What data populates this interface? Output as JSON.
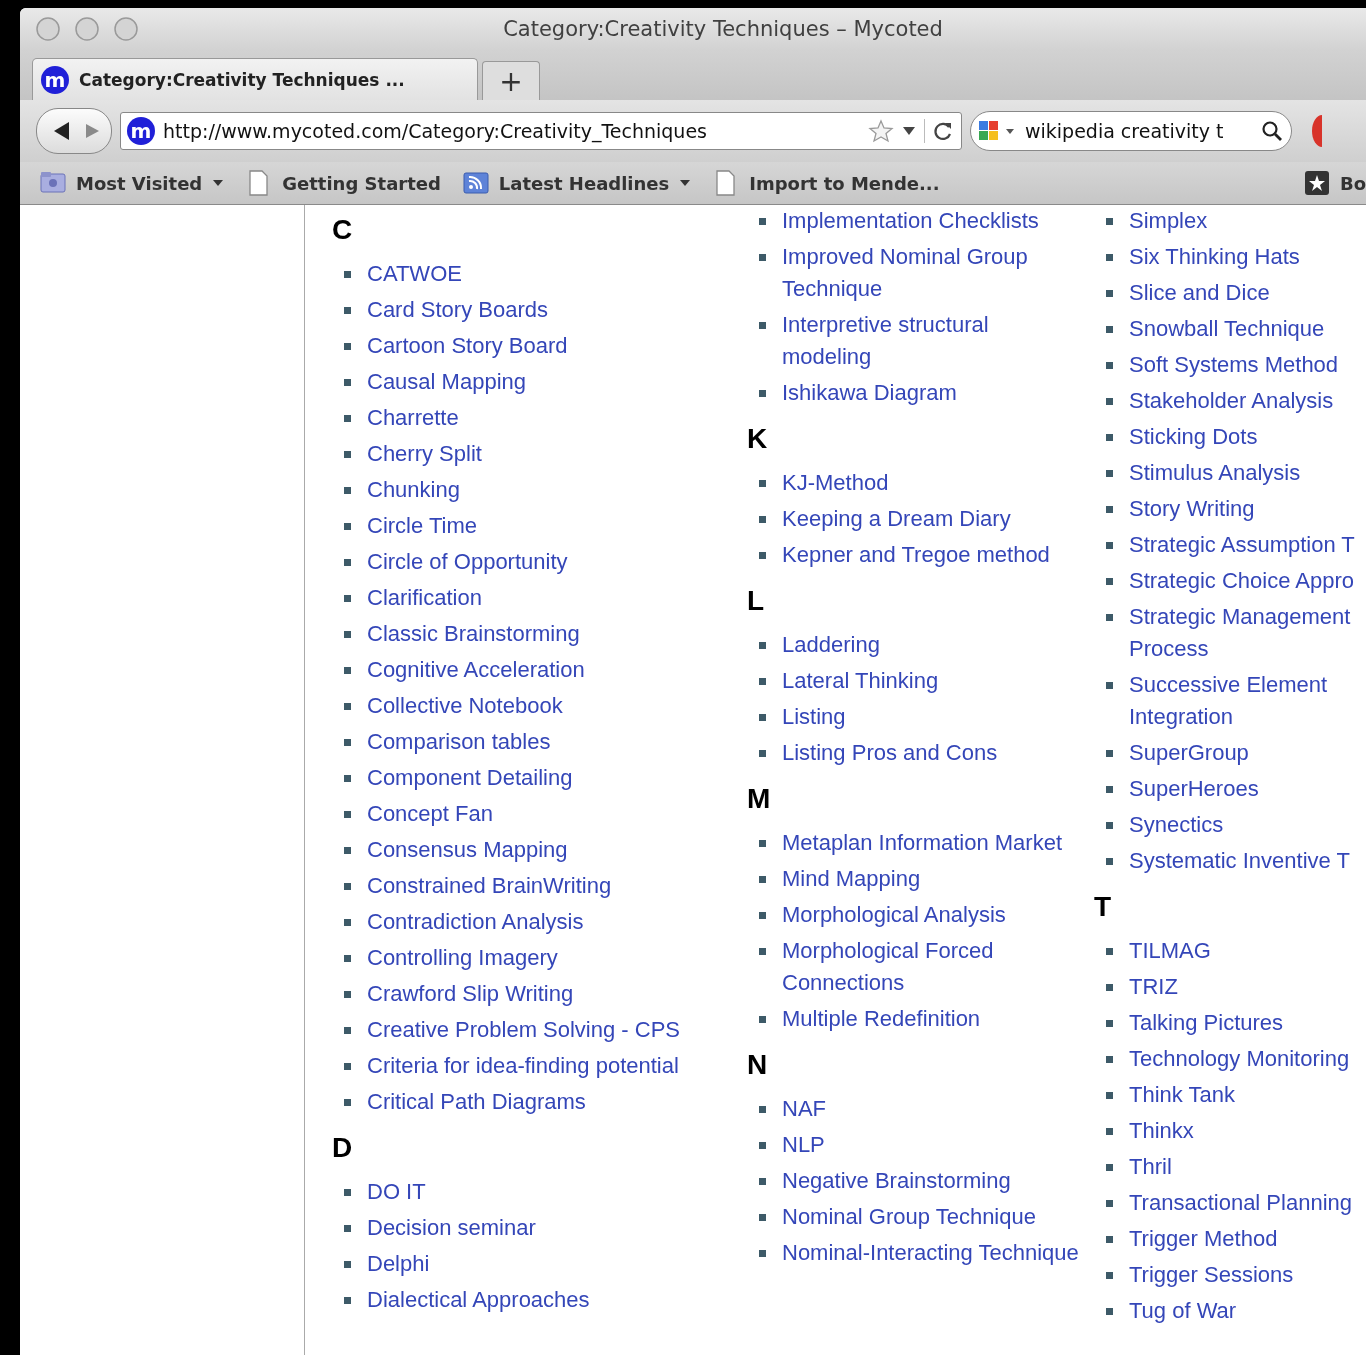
{
  "window": {
    "title": "Category:Creativity Techniques – Mycoted"
  },
  "tabs": [
    {
      "label": "Category:Creativity Techniques ...",
      "favicon": "m",
      "selected": true
    }
  ],
  "new_tab": "+",
  "address_bar": {
    "favicon": "m",
    "url": "http://www.mycoted.com/Category:Creativity_Techniques"
  },
  "search": {
    "value": "wikipedia creativity t"
  },
  "bookmarks": [
    {
      "label": "Most Visited",
      "kind": "folder",
      "menu": true
    },
    {
      "label": "Getting Started",
      "kind": "page",
      "menu": false
    },
    {
      "label": "Latest Headlines",
      "kind": "feed",
      "menu": true
    },
    {
      "label": "Import to Mende...",
      "kind": "page",
      "menu": false
    },
    {
      "label": "Bo",
      "kind": "star",
      "menu": false
    }
  ],
  "columns": [
    {
      "sections": [
        {
          "heading": "C",
          "items": [
            "CATWOE",
            "Card Story Boards",
            "Cartoon Story Board",
            "Causal Mapping",
            "Charrette",
            "Cherry Split",
            "Chunking",
            "Circle Time",
            "Circle of Opportunity",
            "Clarification",
            "Classic Brainstorming",
            "Cognitive Acceleration",
            "Collective Notebook",
            "Comparison tables",
            "Component Detailing",
            "Concept Fan",
            "Consensus Mapping",
            "Constrained BrainWriting",
            "Contradiction Analysis",
            "Controlling Imagery",
            "Crawford Slip Writing",
            "Creative Problem Solving - CPS",
            "Criteria for idea-finding potential",
            "Critical Path Diagrams"
          ]
        },
        {
          "heading": "D",
          "items": [
            "DO IT",
            "Decision seminar",
            "Delphi",
            "Dialectical Approaches"
          ]
        }
      ]
    },
    {
      "sections": [
        {
          "items": [
            "Implementation Checklists",
            "Improved Nominal Group Technique",
            "Interpretive structural modeling",
            "Ishikawa Diagram"
          ]
        },
        {
          "heading": "K",
          "items": [
            "KJ-Method",
            "Keeping a Dream Diary",
            "Kepner and Tregoe method"
          ]
        },
        {
          "heading": "L",
          "items": [
            "Laddering",
            "Lateral Thinking",
            "Listing",
            "Listing Pros and Cons"
          ]
        },
        {
          "heading": "M",
          "items": [
            "Metaplan Information Market",
            "Mind Mapping",
            "Morphological Analysis",
            "Morphological Forced Connections",
            "Multiple Redefinition"
          ]
        },
        {
          "heading": "N",
          "items": [
            "NAF",
            "NLP",
            "Negative Brainstorming",
            "Nominal Group Technique",
            "Nominal-Interacting Technique"
          ]
        }
      ]
    },
    {
      "sections": [
        {
          "items": [
            "Simplex",
            "Six Thinking Hats",
            "Slice and Dice",
            "Snowball Technique",
            "Soft Systems Method",
            "Stakeholder Analysis",
            "Sticking Dots",
            "Stimulus Analysis",
            "Story Writing",
            "Strategic Assumption T",
            "Strategic Choice Appro",
            "Strategic Management Process",
            "Successive Element Integration",
            "SuperGroup",
            "SuperHeroes",
            "Synectics",
            "Systematic Inventive T"
          ]
        },
        {
          "heading": "T",
          "items": [
            "TILMAG",
            "TRIZ",
            "Talking Pictures",
            "Technology Monitoring",
            "Think Tank",
            "Thinkx",
            "Thril",
            "Transactional Planning",
            "Trigger Method",
            "Trigger Sessions",
            "Tug of War"
          ]
        }
      ]
    }
  ]
}
